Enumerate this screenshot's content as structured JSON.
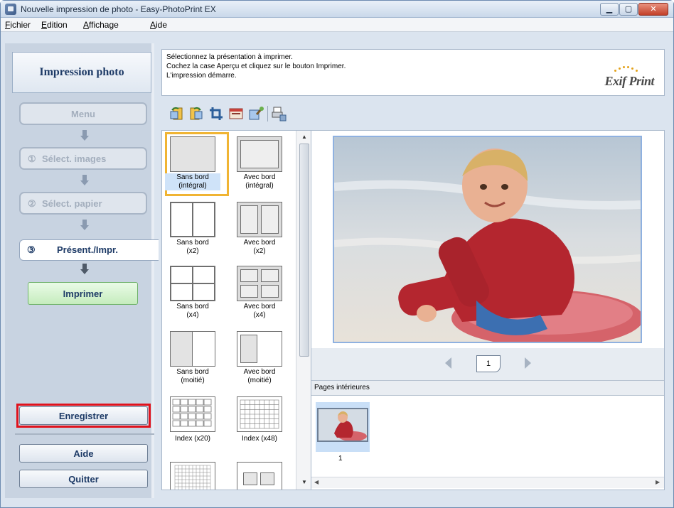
{
  "window": {
    "title": "Nouvelle impression de photo - Easy-PhotoPrint EX",
    "min_glyph": "▁",
    "max_glyph": "▢",
    "close_glyph": "✕"
  },
  "menubar": {
    "items": [
      {
        "first": "F",
        "rest": "ichier"
      },
      {
        "first": "E",
        "rest": "dition"
      },
      {
        "first": "A",
        "rest": "ffichage"
      },
      {
        "first": "A",
        "rest": "ide"
      }
    ]
  },
  "sidebar": {
    "header": "Impression photo",
    "menu": "Menu",
    "steps": [
      {
        "num": "①",
        "label": "Sélect. images"
      },
      {
        "num": "②",
        "label": "Sélect. papier"
      },
      {
        "num": "③",
        "label": "Présent./Impr."
      }
    ],
    "print": "Imprimer",
    "save": "Enregistrer",
    "help": "Aide",
    "quit": "Quitter"
  },
  "instructions": {
    "line1": "Sélectionnez la présentation à imprimer.",
    "line2": "Cochez la case Aperçu et cliquez sur le bouton Imprimer.",
    "line3": "L'impression démarre.",
    "logo": "Exif Print"
  },
  "layouts": [
    {
      "line1": "Sans bord",
      "line2": "(intégral)"
    },
    {
      "line1": "Avec bord",
      "line2": "(intégral)"
    },
    {
      "line1": "Sans bord",
      "line2": "(x2)"
    },
    {
      "line1": "Avec bord",
      "line2": "(x2)"
    },
    {
      "line1": "Sans bord",
      "line2": "(x4)"
    },
    {
      "line1": "Avec bord",
      "line2": "(x4)"
    },
    {
      "line1": "Sans bord",
      "line2": "(moitié)"
    },
    {
      "line1": "Avec bord",
      "line2": "(moitié)"
    },
    {
      "line1": "Index (x20)",
      "line2": ""
    },
    {
      "line1": "Index (x48)",
      "line2": ""
    }
  ],
  "preview": {
    "page_number": "1",
    "inner_pages_label": "Pages intérieures",
    "inner_page_num": "1"
  },
  "colors": {
    "accent": "#1d3a66",
    "selection": "#f0b433",
    "save_highlight": "#e0121c",
    "print_button": "#c5ecbd"
  }
}
